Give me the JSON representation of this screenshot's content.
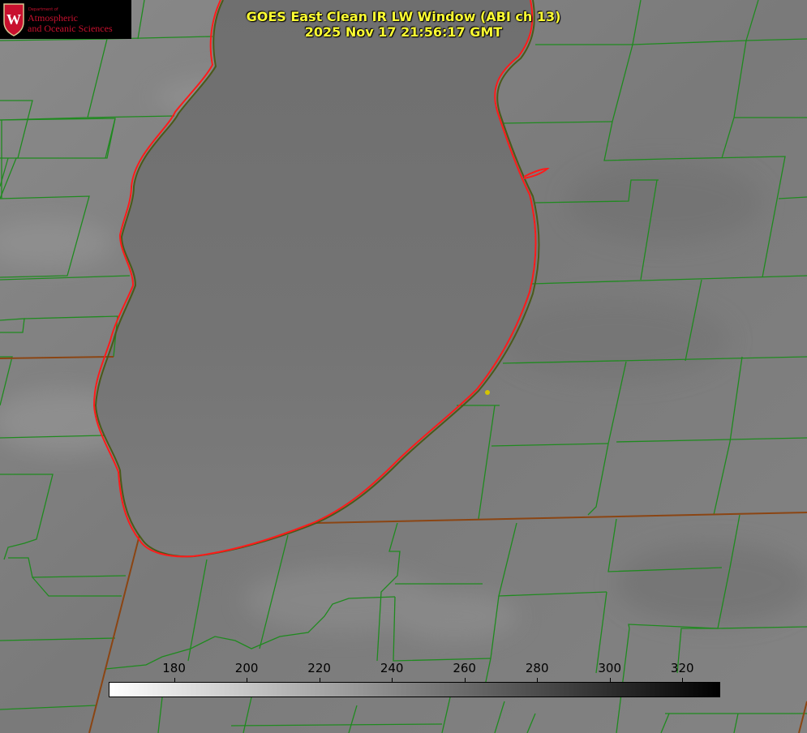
{
  "title": {
    "line1": "GOES East Clean IR LW Window (ABI ch 13)",
    "line2": "2025 Nov 17 21:56:17 GMT"
  },
  "logo": {
    "department": "Department of",
    "line1": "Atmospheric",
    "line2": "and Oceanic Sciences",
    "crest_letter": "W"
  },
  "colorbar": {
    "ticks": [
      {
        "label": "180",
        "value": 180
      },
      {
        "label": "200",
        "value": 200
      },
      {
        "label": "220",
        "value": 220
      },
      {
        "label": "240",
        "value": 240
      },
      {
        "label": "260",
        "value": 260
      },
      {
        "label": "280",
        "value": 280
      },
      {
        "label": "300",
        "value": 300
      },
      {
        "label": "320",
        "value": 320
      }
    ],
    "min_value": 162,
    "max_value": 330,
    "low_color": "#ffffff",
    "high_color": "#000000"
  },
  "colors": {
    "county_lines": "#1f8a1f",
    "state_lines": "#8b4513",
    "lake_outline": "#ff1a1a",
    "marker": "#d4c400",
    "title_text": "#ffff33"
  }
}
